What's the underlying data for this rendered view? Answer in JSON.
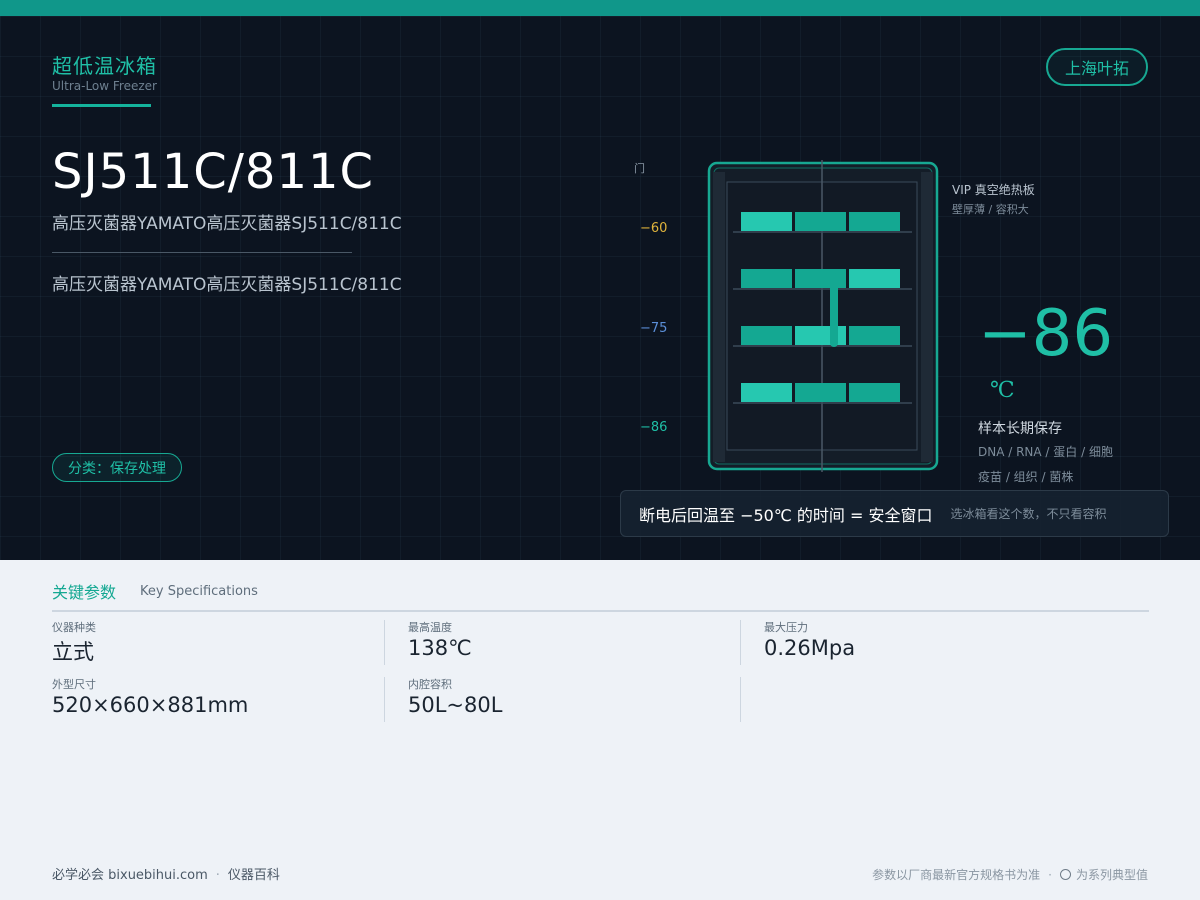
{
  "header": {
    "category_cn": "超低温冰箱",
    "category_en": "Ultra-Low Freezer",
    "brand": "上海叶拓"
  },
  "product": {
    "model": "SJ511C/811C",
    "subtitle_1": "高压灭菌器YAMATO高压灭菌器SJ511C/811C",
    "subtitle_2": "高压灭菌器YAMATO高压灭菌器SJ511C/811C",
    "tag": "分类：保存处理"
  },
  "diagram": {
    "door_label": "门",
    "scale": [
      "−60",
      "−75",
      "−86"
    ],
    "vip_line1": "VIP 真空绝热板",
    "vip_line2": "壁厚薄 / 容积大",
    "temp_value": "−86",
    "temp_unit": "℃",
    "storage_title": "样本长期保存",
    "storage_line1": "DNA / RNA / 蛋白 / 细胞",
    "storage_line2": "疫苗 / 组织 / 菌株",
    "window_main": "断电后回温至 −50℃ 的时间 = 安全窗口",
    "window_note": "选冰箱看这个数，不只看容积",
    "colors": {
      "teal": "#1fbfa6",
      "amber": "#e0b43c",
      "blue": "#5b8fd8"
    }
  },
  "specs": {
    "title": "关键参数",
    "subtitle": "Key Specifications",
    "items": [
      {
        "label": "仪器种类",
        "value": "立式"
      },
      {
        "label": "最高温度",
        "value": "138℃"
      },
      {
        "label": "最大压力",
        "value": "0.26Mpa"
      },
      {
        "label": "外型尺寸",
        "value": "520×660×881mm"
      },
      {
        "label": "内腔容积",
        "value": "50L~80L"
      }
    ]
  },
  "footer": {
    "site": "必学必会 bixuebihui.com",
    "section": "仪器百科",
    "note1": "参数以厂商最新官方规格书为准",
    "note2": "为系列典型值"
  }
}
